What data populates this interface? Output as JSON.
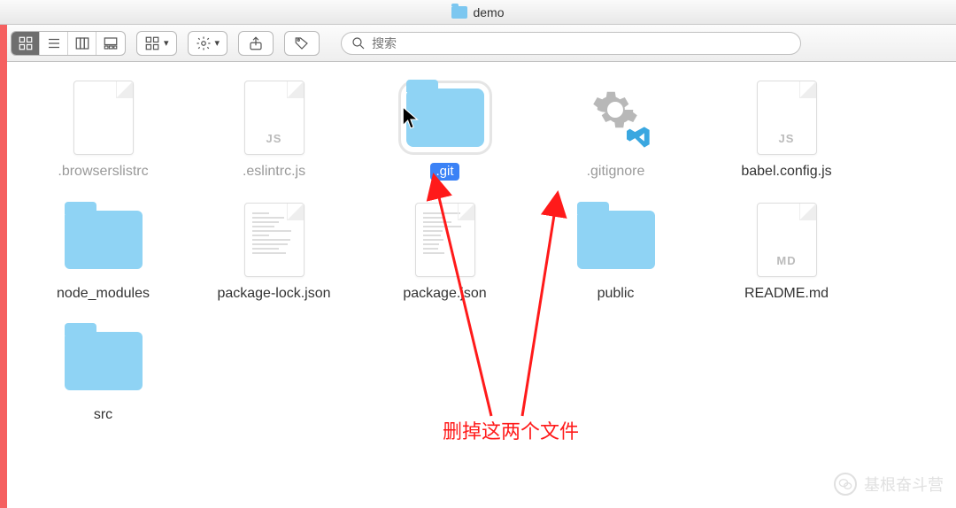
{
  "title": "demo",
  "search": {
    "placeholder": "搜索"
  },
  "files": [
    {
      "name": ".browserslistrc",
      "kind": "file",
      "ftype": "",
      "dim": true,
      "selected": false
    },
    {
      "name": ".eslintrc.js",
      "kind": "file",
      "ftype": "JS",
      "dim": true,
      "selected": false
    },
    {
      "name": ".git",
      "kind": "folder",
      "ftype": "",
      "dim": false,
      "selected": true
    },
    {
      "name": ".gitignore",
      "kind": "gitignore",
      "ftype": "",
      "dim": true,
      "selected": false
    },
    {
      "name": "babel.config.js",
      "kind": "file",
      "ftype": "JS",
      "dim": false,
      "selected": false
    },
    {
      "name": "node_modules",
      "kind": "folder",
      "ftype": "",
      "dim": false,
      "selected": false
    },
    {
      "name": "package-lock.json",
      "kind": "file",
      "ftype": "",
      "dim": false,
      "selected": false,
      "lines": true
    },
    {
      "name": "package.json",
      "kind": "file",
      "ftype": "",
      "dim": false,
      "selected": false,
      "lines": true
    },
    {
      "name": "public",
      "kind": "folder",
      "ftype": "",
      "dim": false,
      "selected": false
    },
    {
      "name": "README.md",
      "kind": "file",
      "ftype": "MD",
      "dim": false,
      "selected": false
    },
    {
      "name": "src",
      "kind": "folder",
      "ftype": "",
      "dim": false,
      "selected": false
    }
  ],
  "annotation": {
    "text": "删掉这两个文件"
  },
  "watermark": {
    "text": "基根奋斗营"
  }
}
